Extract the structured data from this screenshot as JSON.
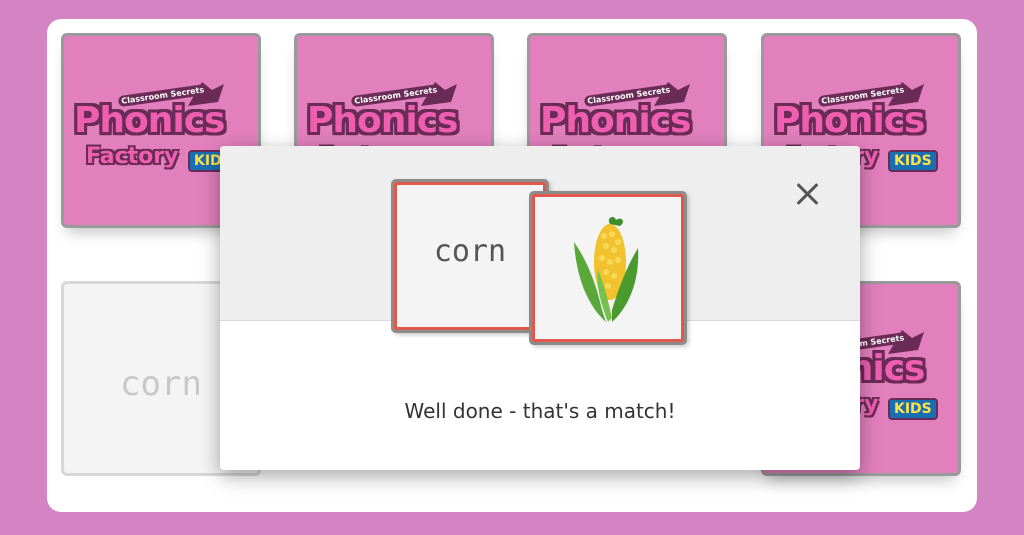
{
  "background_color": "#d484c2",
  "board": {
    "logo": {
      "brand_top": "Classroom Secrets",
      "brand_main": "Phonics",
      "brand_sub": "Factory",
      "brand_badge": "KIDS"
    },
    "cards": [
      {
        "state": "face-down",
        "content": "logo"
      },
      {
        "state": "face-down",
        "content": "logo"
      },
      {
        "state": "face-down",
        "content": "logo"
      },
      {
        "state": "face-down",
        "content": "logo"
      },
      {
        "state": "face-up",
        "word": "corn"
      },
      {
        "state": "face-down",
        "content": "logo"
      }
    ]
  },
  "modal": {
    "close_icon": "close-icon",
    "word_card": {
      "word": "corn"
    },
    "picture_card": {
      "icon": "corn-icon"
    },
    "message": "Well done - that's a match!",
    "accent_color": "#e0574c"
  }
}
